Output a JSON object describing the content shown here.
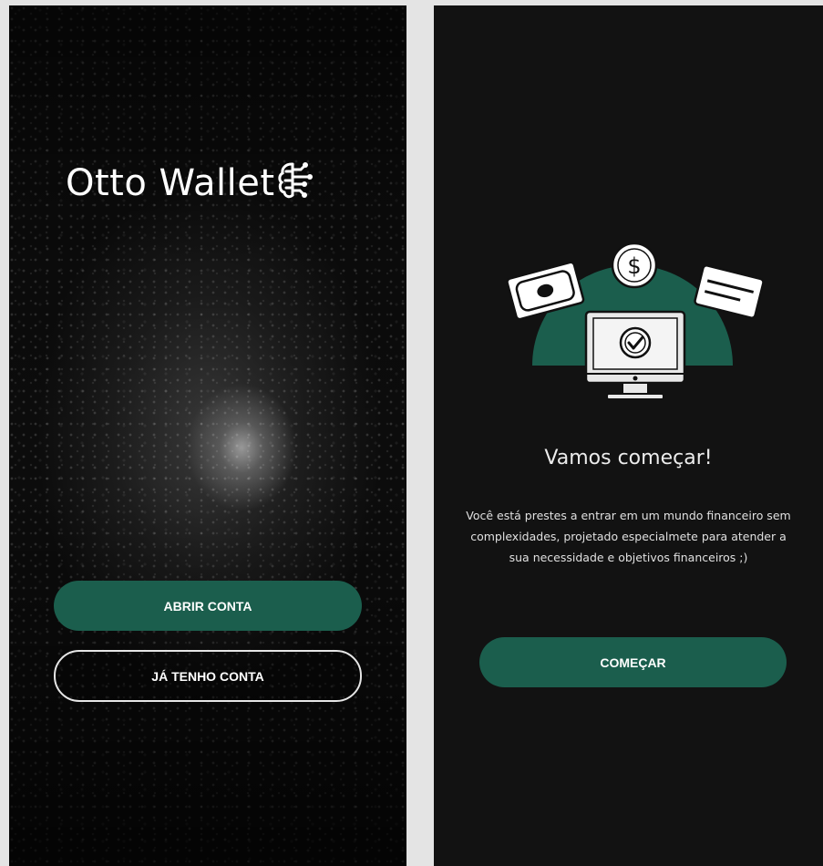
{
  "welcome": {
    "brand": "Otto Wallet",
    "open_account_label": "ABRIR CONTA",
    "have_account_label": "JÁ TENHO CONTA"
  },
  "onboarding": {
    "title": "Vamos começar!",
    "description": "Você está prestes a entrar em um mundo financeiro sem complexidades, projetado especialmete para atender a sua necessidade e objetivos financeiros ;)",
    "start_label": "COMEÇAR",
    "dollar_symbol": "$"
  },
  "colors": {
    "accent": "#1b5e4d",
    "dark_background": "#121212",
    "page_background": "#e4e4e4"
  },
  "icons": [
    "circuit-brain-icon",
    "banknote-icon",
    "dollar-coin-icon",
    "credit-card-icon",
    "monitor-check-icon"
  ]
}
